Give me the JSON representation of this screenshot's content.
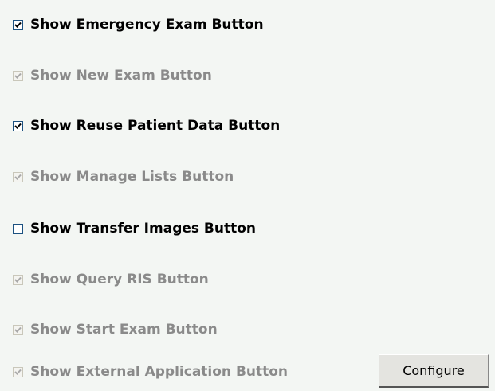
{
  "options": [
    {
      "label": "Show Emergency Exam Button",
      "checked": true,
      "enabled": true
    },
    {
      "label": "Show New Exam Button",
      "checked": true,
      "enabled": false
    },
    {
      "label": "Show Reuse Patient Data Button",
      "checked": true,
      "enabled": true
    },
    {
      "label": "Show Manage Lists Button",
      "checked": true,
      "enabled": false
    },
    {
      "label": "Show Transfer Images Button",
      "checked": false,
      "enabled": true
    },
    {
      "label": "Show Query RIS Button",
      "checked": true,
      "enabled": false
    },
    {
      "label": "Show Start Exam Button",
      "checked": true,
      "enabled": false
    },
    {
      "label": "Show External Application Button",
      "checked": true,
      "enabled": false
    }
  ],
  "configure_button": {
    "label": "Configure"
  },
  "colors": {
    "background": "#f3f6f3",
    "checkbox_border": "#1c5180",
    "check_mark": "#000000",
    "disabled_check_mark": "#a9a9a9",
    "disabled_text": "#8a8a8a"
  }
}
